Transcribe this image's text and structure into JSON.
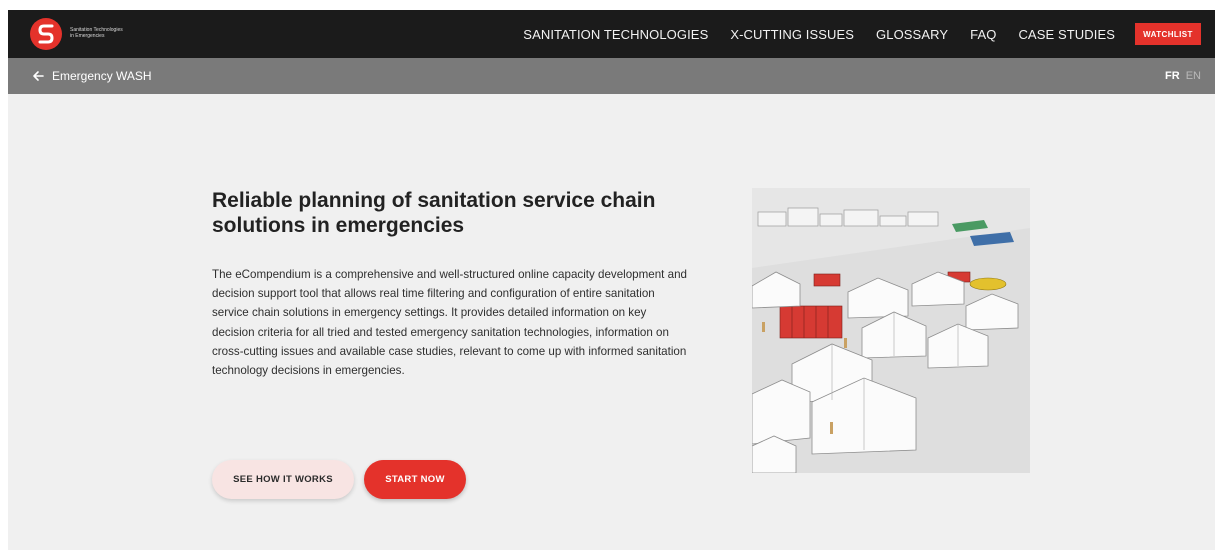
{
  "header": {
    "logo_text_line1": "Sanitation Technologies",
    "logo_text_line2": "in Emergencies",
    "nav": [
      {
        "label": "SANITATION TECHNOLOGIES"
      },
      {
        "label": "X-CUTTING ISSUES"
      },
      {
        "label": "GLOSSARY"
      },
      {
        "label": "FAQ"
      },
      {
        "label": "CASE STUDIES"
      }
    ],
    "watchlist_label": "WATCHLIST"
  },
  "subbar": {
    "back_label": "Emergency WASH",
    "languages": [
      "FR",
      "EN"
    ],
    "active_language": "FR"
  },
  "hero": {
    "title": "Reliable planning of sanitation service chain solutions in emergencies",
    "body": "The eCompendium is a comprehensive and well-structured online capacity development and decision support tool that allows real time filtering and configuration of entire sanitation service chain solutions in emergency settings. It provides detailed information on key decision criteria for all tried and tested emergency sanitation technologies, information on cross-cutting issues and available case studies, relevant to come up with informed sanitation technology decisions in emergencies.",
    "secondary_button": "SEE HOW IT WORKS",
    "primary_button": "START NOW"
  },
  "colors": {
    "brand_red": "#e4322b",
    "topbar": "#1b1b1b",
    "subbar": "#7a7a7a",
    "background": "#f0f0f0"
  }
}
